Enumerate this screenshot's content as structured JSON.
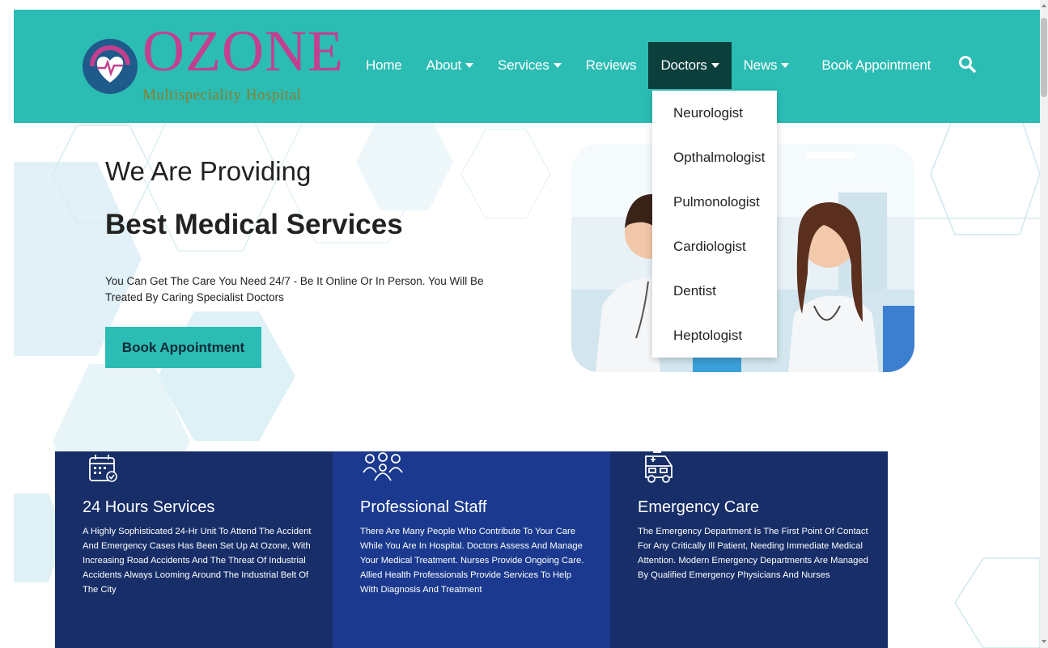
{
  "brand": {
    "title": "OZONE",
    "subtitle": "Multispeciality Hospital"
  },
  "nav": {
    "items": [
      {
        "label": "Home"
      },
      {
        "label": "About"
      },
      {
        "label": "Services"
      },
      {
        "label": "Reviews"
      },
      {
        "label": "Doctors"
      },
      {
        "label": "News"
      },
      {
        "label": "Book Appointment"
      }
    ],
    "search_icon": "search-icon",
    "active": "Doctors"
  },
  "doctors_menu": {
    "items": [
      "Neurologist",
      "Opthalmologist",
      "Pulmonologist",
      "Cardiologist",
      "Dentist",
      "Heptologist"
    ]
  },
  "hero": {
    "title": "We Are Providing",
    "title_strong": "Best Medical Services",
    "description": "You Can Get The Care You Need 24/7 - Be It Online Or In Person. You Will Be Treated By Caring Specialist Doctors",
    "button": "Book Appointment"
  },
  "features": [
    {
      "icon": "calendar-icon",
      "title": "24 Hours Services",
      "text": "A Highly Sophisticated 24-Hr Unit To Attend The Accident And Emergency Cases Has Been Set Up At Ozone, With Increasing Road Accidents And The Threat Of Industrial Accidents Always Looming Around The Industrial Belt Of The City"
    },
    {
      "icon": "staff-group-icon",
      "title": "Professional Staff",
      "text": "There Are Many People Who Contribute To Your Care While You Are In Hospital. Doctors Assess And Manage Your Medical Treatment. Nurses Provide Ongoing Care. Allied Health Professionals Provide Services To Help With Diagnosis And Treatment"
    },
    {
      "icon": "ambulance-icon",
      "title": "Emergency Care",
      "text": "The Emergency Department Is The First Point Of Contact For Any Critically Ill Patient, Needing Immediate Medical Attention. Modern Emergency Departments Are Managed By Qualified Emergency Physicians And Nurses"
    }
  ],
  "colors": {
    "header_teal": "#2bbcb4",
    "nav_active": "#0b3f3b",
    "brand_magenta": "#c2408f",
    "card_dark_navy": "#172e68",
    "card_mid_navy": "#1b3a8f"
  }
}
